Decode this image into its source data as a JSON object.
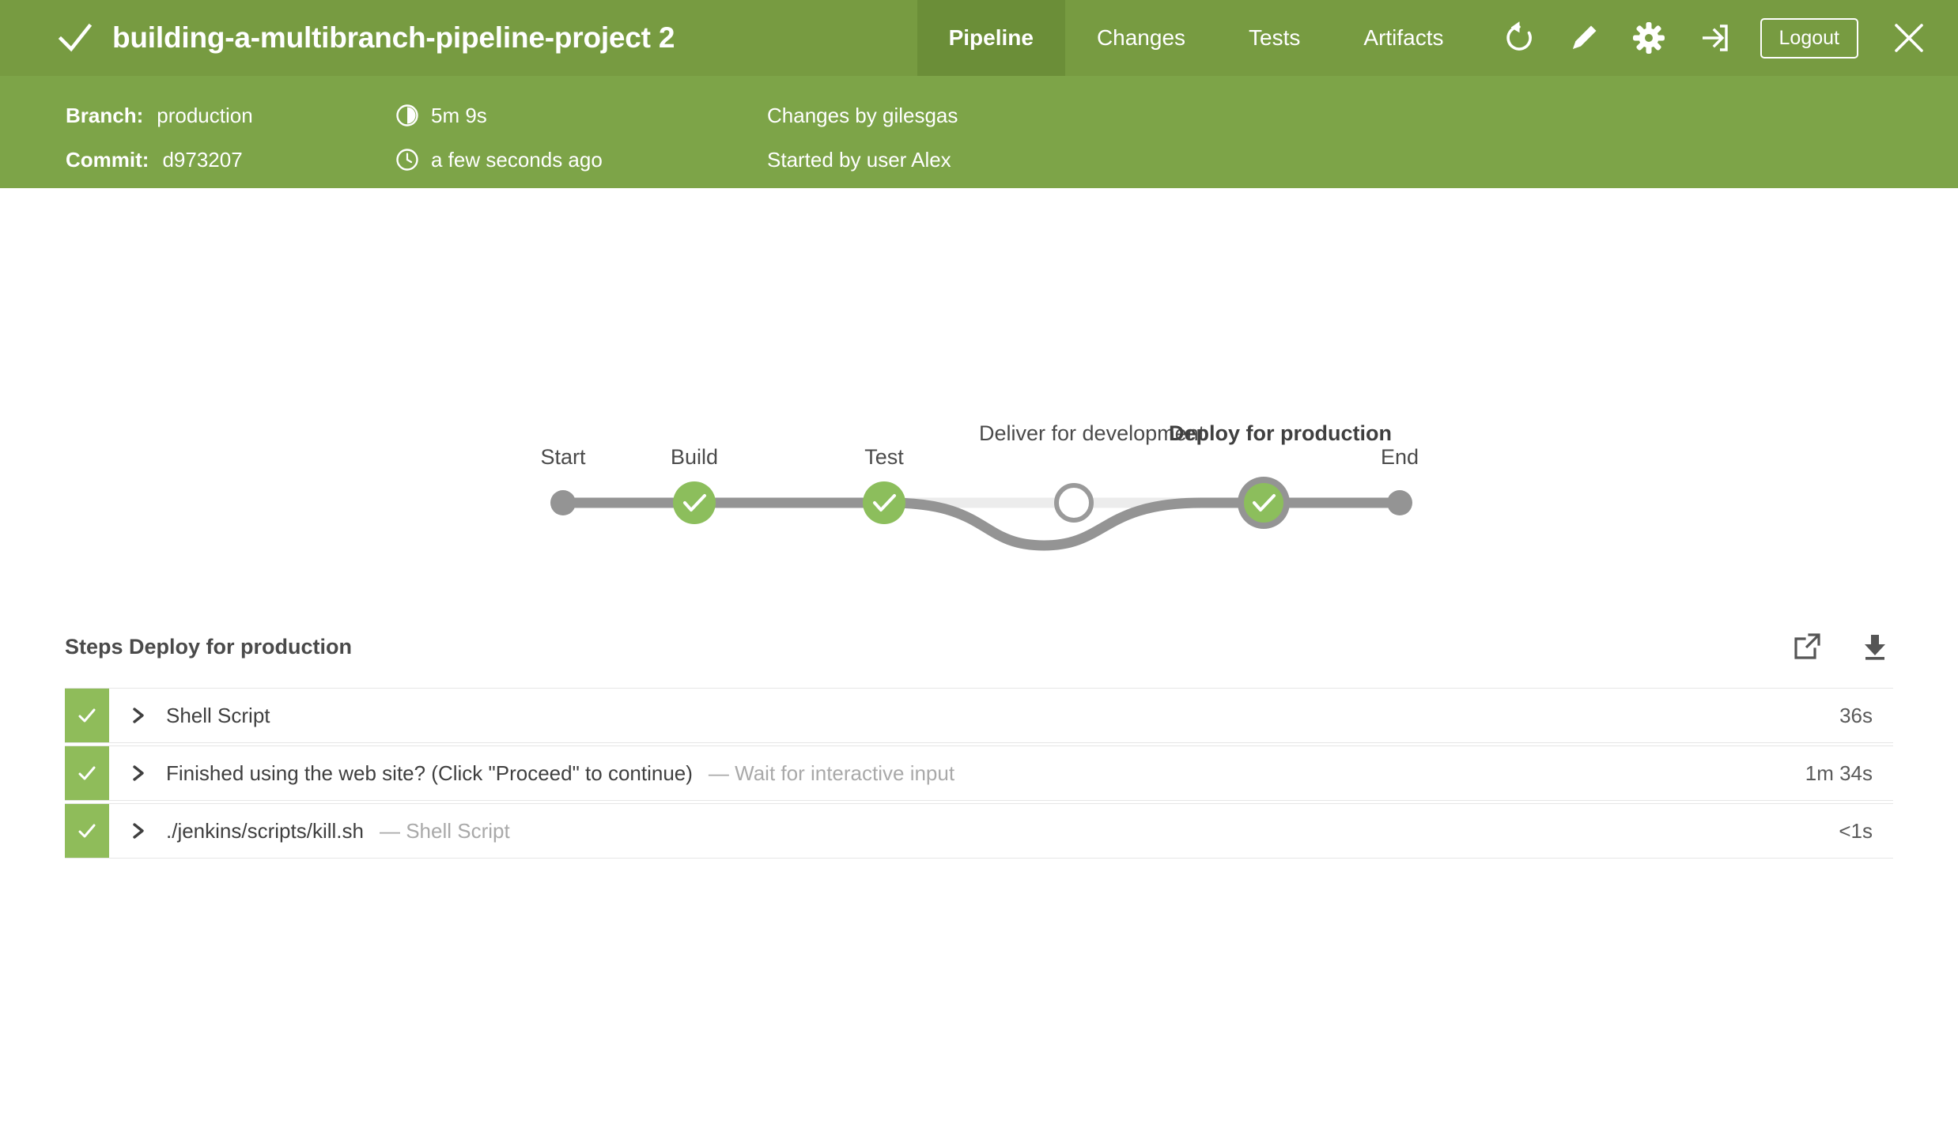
{
  "header": {
    "status_icon": "check-icon",
    "run_title": "building-a-multibranch-pipeline-project 2",
    "tabs": [
      {
        "label": "Pipeline",
        "active": true
      },
      {
        "label": "Changes",
        "active": false
      },
      {
        "label": "Tests",
        "active": false
      },
      {
        "label": "Artifacts",
        "active": false
      }
    ],
    "icons": [
      {
        "name": "replay-icon"
      },
      {
        "name": "edit-pencil-icon"
      },
      {
        "name": "gear-icon"
      },
      {
        "name": "logout-arrow-icon"
      }
    ],
    "logout_label": "Logout",
    "close_icon": "close-icon",
    "background_color": "#779b41",
    "active_tab_color": "#6b8e38"
  },
  "meta": {
    "branch_label": "Branch:",
    "branch_value": "production",
    "commit_label": "Commit:",
    "commit_value": "d973207",
    "duration_icon": "half-filled-clock-icon",
    "duration_value": "5m 9s",
    "time_icon": "clock-icon",
    "time_value": "a few seconds ago",
    "changes_by": "Changes by gilesgas",
    "started_by": "Started by user Alex",
    "background_color": "#7da448"
  },
  "pipeline": {
    "node_green": "#8cbe5c",
    "line_gray": "#949494",
    "line_light": "#ececec",
    "stages": [
      {
        "label": "Start",
        "type": "terminal",
        "status": "start",
        "selected": false
      },
      {
        "label": "Build",
        "type": "stage",
        "status": "success",
        "selected": false
      },
      {
        "label": "Test",
        "type": "stage",
        "status": "success",
        "selected": false
      },
      {
        "label": "Deliver for development",
        "type": "stage",
        "status": "skipped",
        "selected": false
      },
      {
        "label": "Deploy for production",
        "type": "stage",
        "status": "success",
        "selected": true
      },
      {
        "label": "End",
        "type": "terminal",
        "status": "end",
        "selected": false
      }
    ]
  },
  "steps": {
    "title": "Steps Deploy for production",
    "open_icon": "open-in-new-window-icon",
    "download_icon": "download-icon",
    "status_color": "#8fbc5a",
    "rows": [
      {
        "status": "success",
        "expander": "chevron-right-icon",
        "title": "Shell Script",
        "subtitle": "",
        "duration": "36s"
      },
      {
        "status": "success",
        "expander": "chevron-right-icon",
        "title": "Finished using the web site? (Click \"Proceed\" to continue)",
        "subtitle": "— Wait for interactive input",
        "duration": "1m 34s"
      },
      {
        "status": "success",
        "expander": "chevron-right-icon",
        "title": "./jenkins/scripts/kill.sh",
        "subtitle": "— Shell Script",
        "duration": "<1s"
      }
    ]
  }
}
